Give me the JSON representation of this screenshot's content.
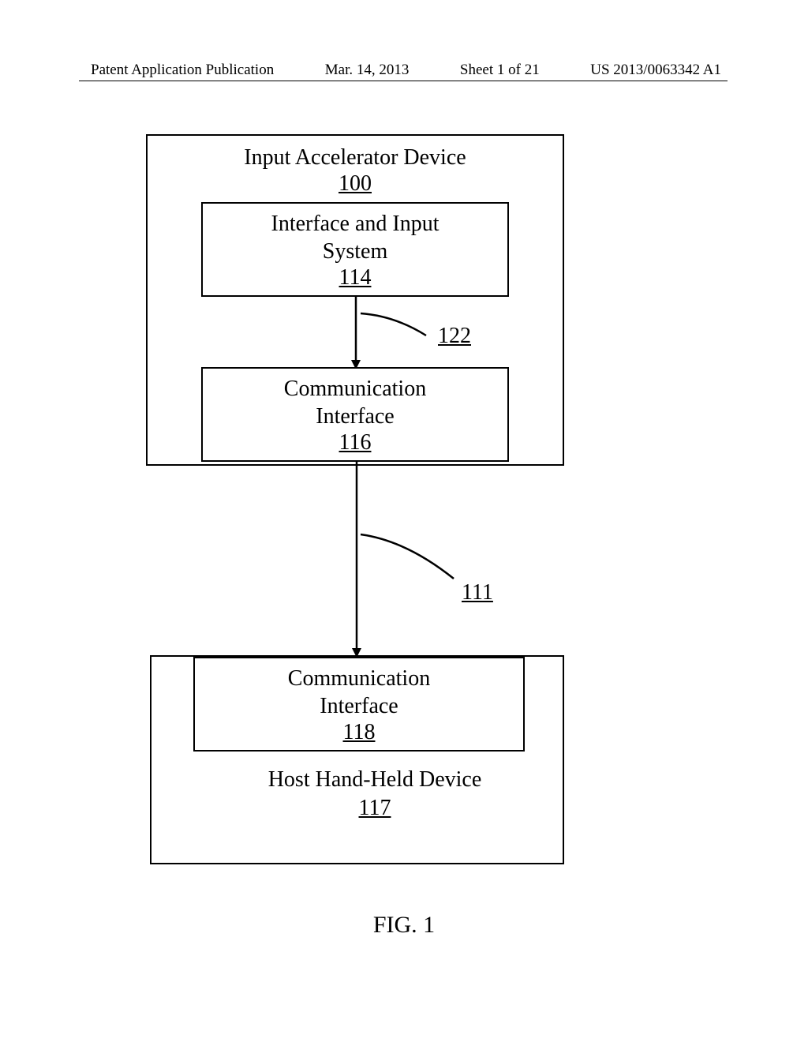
{
  "header": {
    "pub_label": "Patent Application Publication",
    "date": "Mar. 14, 2013",
    "sheet": "Sheet 1 of 21",
    "pub_number": "US 2013/0063342 A1"
  },
  "boxes": {
    "outer_top_title": "Input Accelerator Device",
    "outer_top_ref": "100",
    "inner_114_title1": "Interface and Input",
    "inner_114_title2": "System",
    "inner_114_ref": "114",
    "inner_116_title1": "Communication",
    "inner_116_title2": "Interface",
    "inner_116_ref": "116",
    "inner_118_title1": "Communication",
    "inner_118_title2": "Interface",
    "inner_118_ref": "118",
    "host_title": "Host Hand-Held Device",
    "host_ref": "117"
  },
  "connectors": {
    "ref_122": "122",
    "ref_111": "111"
  },
  "figure_label": "FIG. 1"
}
